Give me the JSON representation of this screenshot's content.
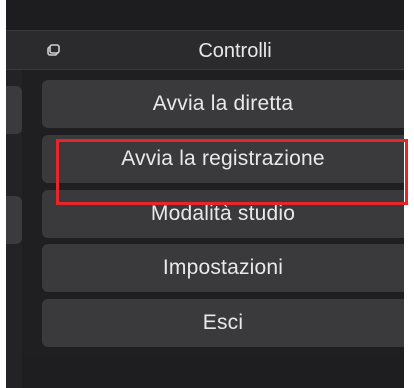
{
  "dock": {
    "title": "Controlli",
    "icon": "dock-float-icon"
  },
  "controls": [
    {
      "label": "Avvia la diretta"
    },
    {
      "label": "Avvia la registrazione"
    },
    {
      "label": "Modalità studio"
    },
    {
      "label": "Impostazioni"
    },
    {
      "label": "Esci"
    }
  ],
  "colors": {
    "background": "#1f1f21",
    "button": "#3a3a3d",
    "text": "#e9e9eb",
    "highlight": "#e8262a"
  }
}
